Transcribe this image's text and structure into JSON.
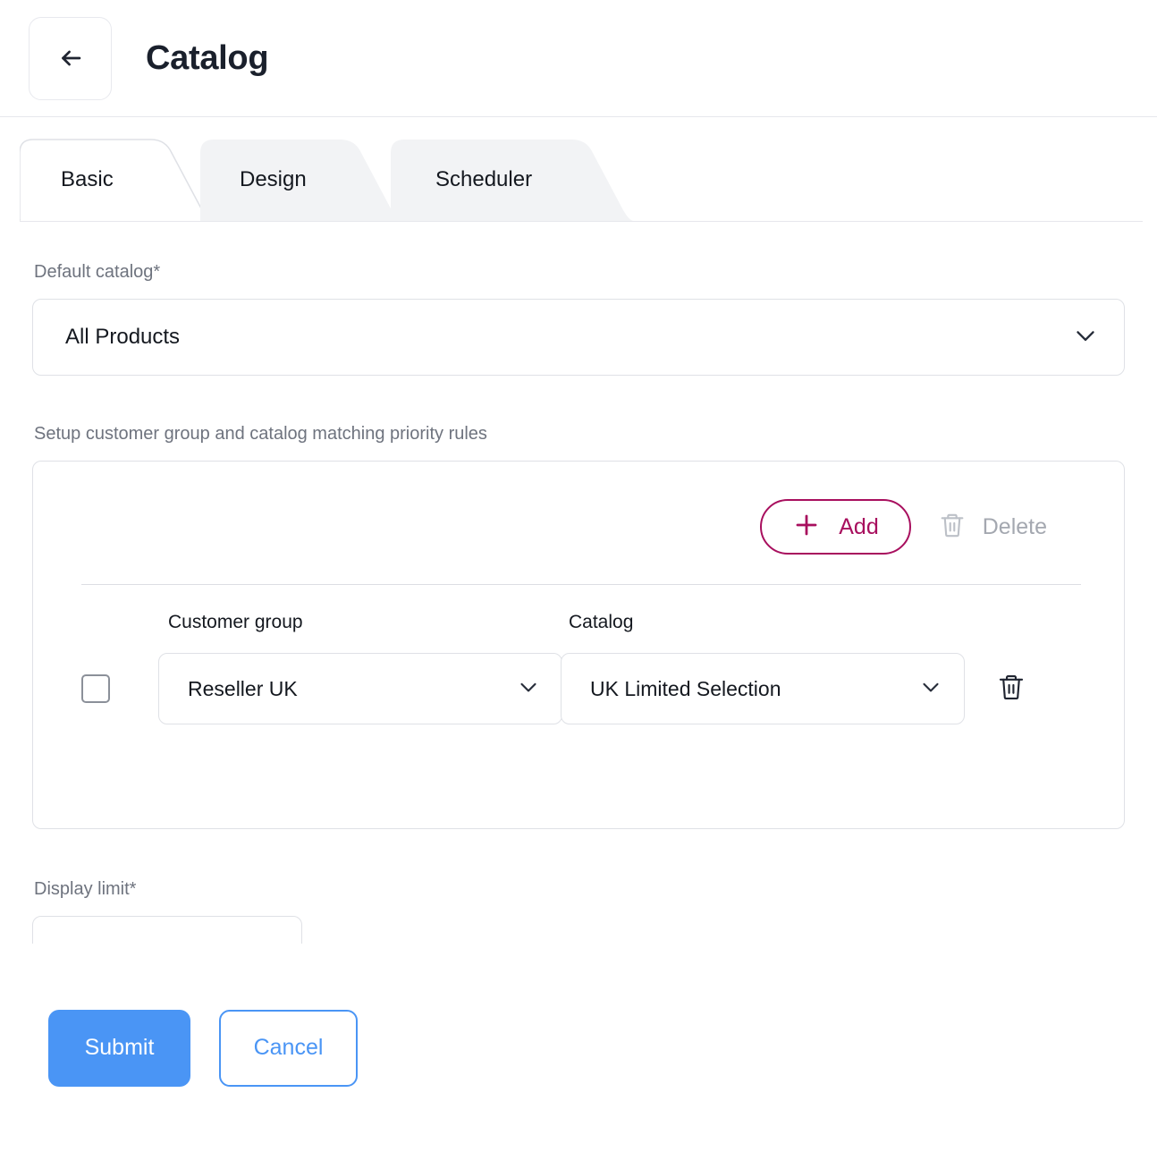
{
  "header": {
    "title": "Catalog",
    "back_icon": "arrow-left-icon"
  },
  "tabs": [
    {
      "id": "basic",
      "label": "Basic",
      "active": true
    },
    {
      "id": "design",
      "label": "Design",
      "active": false
    },
    {
      "id": "scheduler",
      "label": "Scheduler",
      "active": false
    }
  ],
  "form": {
    "default_catalog": {
      "label": "Default catalog*",
      "value": "All Products",
      "chevron_icon": "chevron-down-icon"
    },
    "rules_section": {
      "label": "Setup customer group and catalog matching priority rules",
      "add_label": "Add",
      "add_icon": "plus-icon",
      "delete_label": "Delete",
      "delete_icon": "trash-icon",
      "delete_disabled": true,
      "columns": {
        "customer_group": "Customer group",
        "catalog": "Catalog"
      },
      "rows": [
        {
          "selected": false,
          "customer_group": "Reseller UK",
          "catalog": "UK Limited Selection",
          "row_delete_icon": "trash-icon"
        }
      ]
    },
    "display_limit": {
      "label": "Display limit*",
      "value": ""
    }
  },
  "footer": {
    "submit_label": "Submit",
    "cancel_label": "Cancel"
  },
  "colors": {
    "accent_magenta": "#a80f5e",
    "primary_blue": "#4a95f5",
    "text_dark": "#14181f",
    "text_muted": "#6e737e",
    "border": "#dfe1e6"
  }
}
